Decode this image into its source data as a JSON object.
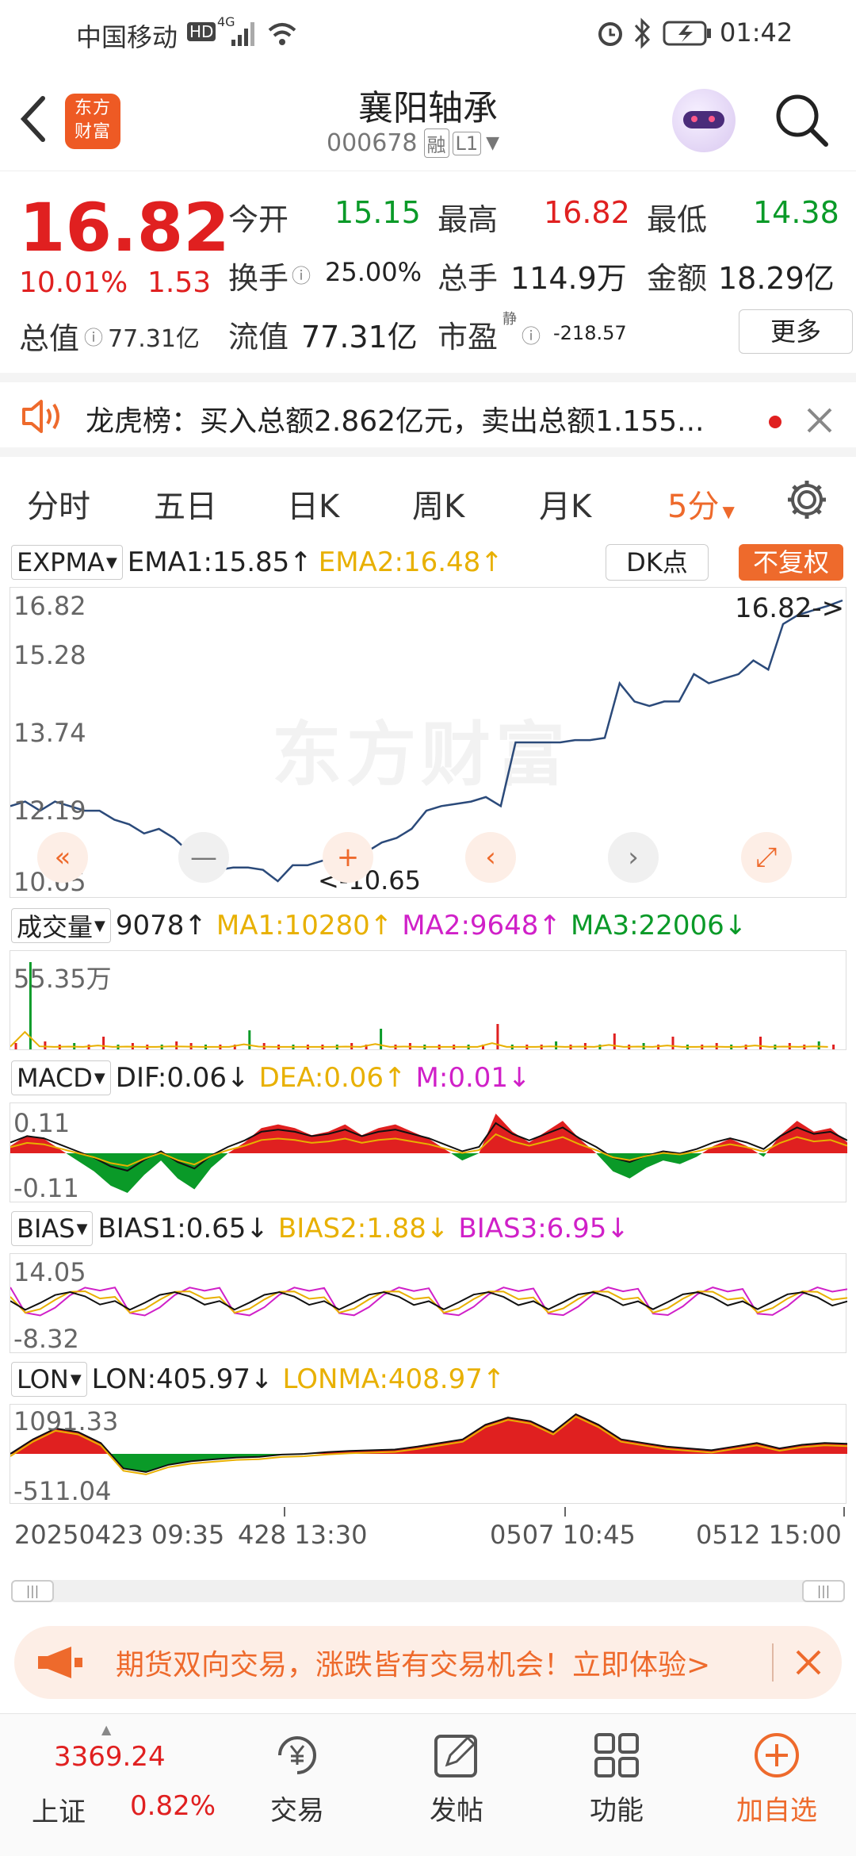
{
  "status_bar": {
    "carrier": "中国移动",
    "hd": "HD",
    "network": "4G",
    "time": "01:42"
  },
  "header": {
    "title": "襄阳轴承",
    "code": "000678",
    "tag_margin": "融",
    "tag_level": "L1",
    "logo_text": "东方财富"
  },
  "quote": {
    "price": "16.82",
    "change_pct": "10.01%",
    "change_amt": "1.53",
    "total_value_label": "总值",
    "total_value": "77.31亿",
    "open_label": "今开",
    "open": "15.15",
    "high_label": "最高",
    "high": "16.82",
    "low_label": "最低",
    "low": "14.38",
    "turnover_label": "换手",
    "turnover": "25.00%",
    "volume_label": "总手",
    "volume": "114.9万",
    "amount_label": "金额",
    "amount": "18.29亿",
    "float_label": "流值",
    "float_value": "77.31亿",
    "pe_label": "市盈",
    "pe_sup": "静",
    "pe": "-218.57",
    "more_button": "更多"
  },
  "notice": {
    "text": "龙虎榜：买入总额2.862亿元，卖出总额1.155..."
  },
  "tabs": {
    "items": [
      "分时",
      "五日",
      "日K",
      "周K",
      "月K"
    ],
    "active": "5分"
  },
  "main_chart": {
    "indicator": "EXPMA",
    "ema1": "EMA1:15.85",
    "ema2": "EMA2:16.48",
    "dk_button": "DK点",
    "fq_button": "不复权",
    "y_labels": [
      "16.82",
      "15.28",
      "13.74",
      "12.19",
      "10.65"
    ],
    "last_marker": "16.82->",
    "low_marker": "<-10.65",
    "watermark": "东方财富"
  },
  "volume_panel": {
    "indicator": "成交量",
    "value": "9078",
    "ma1": "MA1:10280",
    "ma2": "MA2:9648",
    "ma3": "MA3:22006",
    "y_max": "55.35万"
  },
  "macd_panel": {
    "indicator": "MACD",
    "dif": "DIF:0.06",
    "dea": "DEA:0.06",
    "m": "M:0.01",
    "y_max": "0.11",
    "y_min": "-0.11"
  },
  "bias_panel": {
    "indicator": "BIAS",
    "bias1": "BIAS1:0.65",
    "bias2": "BIAS2:1.88",
    "bias3": "BIAS3:6.95",
    "y_max": "14.05",
    "y_min": "-8.32"
  },
  "lon_panel": {
    "indicator": "LON",
    "lon": "LON:405.97",
    "lonma": "LONMA:408.97",
    "y_max": "1091.33",
    "y_min": "-511.04"
  },
  "time_axis": {
    "left": "20250423 09:35",
    "left2": "428 13:30",
    "mid": "0507 10:45",
    "right": "0512 15:00"
  },
  "ad_banner": {
    "text": "期货双向交易，涨跌皆有交易机会！立即体验>"
  },
  "bottom_nav": {
    "index_value": "3369.24",
    "index_name": "上证",
    "index_change": "0.82%",
    "trade": "交易",
    "post": "发帖",
    "functions": "功能",
    "add_watch": "加自选"
  },
  "colors": {
    "up": "#e02020",
    "down": "#0a9a28",
    "accent": "#ee6a2c",
    "price_line": "#2b4a7a"
  },
  "chart_data": {
    "type": "line",
    "title": "",
    "ylim": [
      10.65,
      16.82
    ],
    "price_series": {
      "name": "",
      "values": [
        12.3,
        12.4,
        12.2,
        12.4,
        12.3,
        12.2,
        12.2,
        12.0,
        11.9,
        11.7,
        11.8,
        11.6,
        11.3,
        11.0,
        10.9,
        10.95,
        10.95,
        10.9,
        10.65,
        11.0,
        11.0,
        11.1,
        11.15,
        11.2,
        11.3,
        11.5,
        11.6,
        11.8,
        12.2,
        12.3,
        12.35,
        12.4,
        12.5,
        12.3,
        13.7,
        13.7,
        13.7,
        13.7,
        13.75,
        13.75,
        13.8,
        15.0,
        14.6,
        14.5,
        14.6,
        14.6,
        15.2,
        15.0,
        15.1,
        15.2,
        15.5,
        15.3,
        16.3,
        16.5,
        16.6,
        16.7,
        16.82
      ]
    },
    "volume_values": [
      4,
      55,
      5,
      3,
      4,
      3,
      8,
      3,
      4,
      3,
      3,
      5,
      4,
      3,
      3,
      3,
      12,
      4,
      3,
      3,
      3,
      3,
      3,
      4,
      3,
      13,
      3,
      4,
      3,
      3,
      3,
      3,
      3,
      16,
      3,
      3,
      3,
      5,
      3,
      4,
      3,
      10,
      3,
      4,
      3,
      8,
      3,
      3,
      4,
      3,
      3,
      8,
      3,
      4,
      3,
      5,
      3
    ],
    "macd_values": [
      0.02,
      0.05,
      0.04,
      0.01,
      -0.02,
      -0.05,
      -0.09,
      -0.11,
      -0.06,
      -0.02,
      -0.07,
      -0.1,
      -0.04,
      0.0,
      0.03,
      0.07,
      0.08,
      0.07,
      0.05,
      0.06,
      0.08,
      0.05,
      0.07,
      0.08,
      0.06,
      0.04,
      0.01,
      -0.02,
      0.0,
      0.11,
      0.06,
      0.03,
      0.06,
      0.09,
      0.04,
      0.0,
      -0.05,
      -0.07,
      -0.04,
      -0.02,
      -0.03,
      -0.01,
      0.02,
      0.04,
      0.02,
      -0.01,
      0.05,
      0.09,
      0.06,
      0.07,
      0.03
    ],
    "lon_values": [
      0,
      400,
      700,
      600,
      300,
      -400,
      -500,
      -300,
      -200,
      -150,
      -100,
      -80,
      -20,
      0,
      50,
      80,
      100,
      120,
      200,
      300,
      400,
      800,
      1000,
      900,
      600,
      1091,
      800,
      400,
      300,
      200,
      150,
      100,
      200,
      300,
      150,
      250,
      300,
      280
    ]
  }
}
